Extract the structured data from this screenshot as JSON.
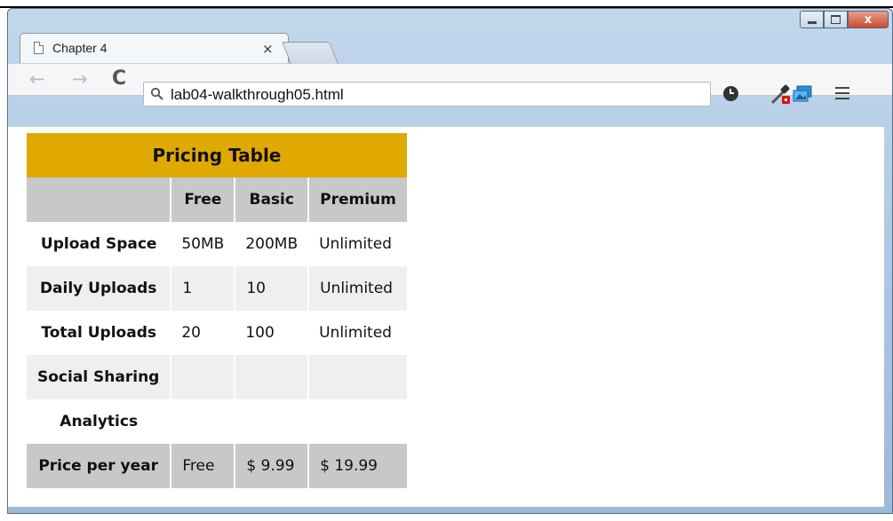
{
  "browser": {
    "tab_title": "Chapter 4",
    "tab_close": "×",
    "url": "lab04-walkthrough05.html",
    "caption_close": "x"
  },
  "nav": {
    "back": "←",
    "forward": "→",
    "reload": "C",
    "search_glyph": "🔍"
  },
  "icons": [
    "history-icon",
    "color-picker-icon",
    "screenshot-icon",
    "menu-icon",
    "page-icon"
  ],
  "pricing_table": {
    "caption": "Pricing Table",
    "columns": [
      "Free",
      "Basic",
      "Premium"
    ],
    "rows": [
      {
        "label": "Upload Space",
        "values": [
          "50MB",
          "200MB",
          "Unlimited"
        ]
      },
      {
        "label": "Daily Uploads",
        "values": [
          "1",
          "10",
          "Unlimited"
        ]
      },
      {
        "label": "Total Uploads",
        "values": [
          "20",
          "100",
          "Unlimited"
        ]
      },
      {
        "label": "Social Sharing",
        "values": [
          "",
          "",
          ""
        ]
      },
      {
        "label": "Analytics",
        "values": [
          "",
          "",
          ""
        ]
      }
    ],
    "footer": {
      "label": "Price per year",
      "values": [
        "Free",
        "$ 9.99",
        "$ 19.99"
      ]
    }
  },
  "colors": {
    "caption_bg": "#e0a900",
    "header_bg": "#c8c8c8",
    "alt_row_bg": "#efefef"
  }
}
